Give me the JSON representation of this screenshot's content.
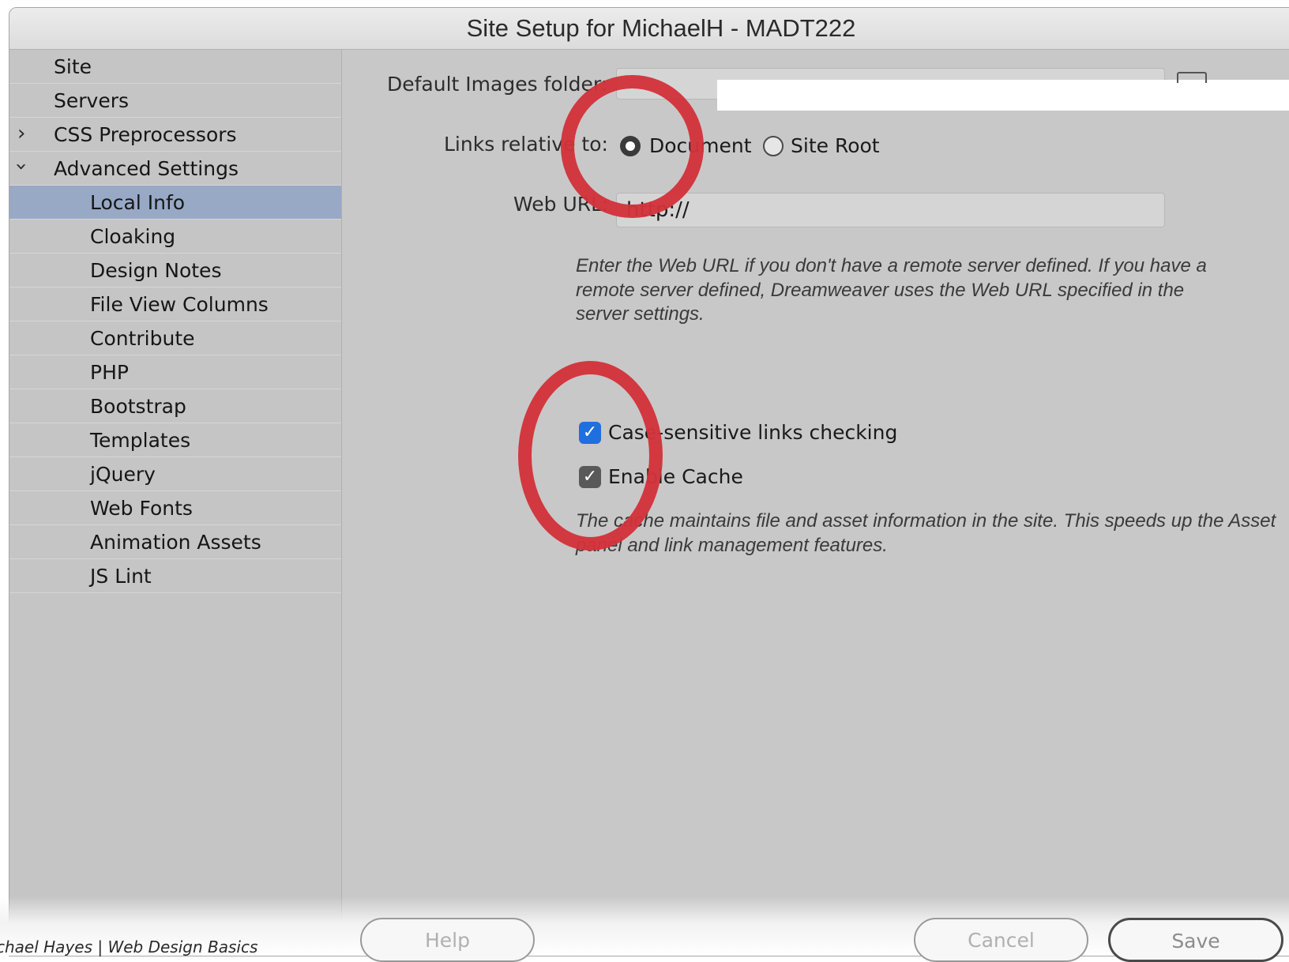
{
  "window": {
    "title": "Site Setup for MichaelH - MADT222"
  },
  "sidebar": {
    "items": [
      {
        "label": "Site"
      },
      {
        "label": "Servers"
      },
      {
        "label": "CSS Preprocessors",
        "chevron": "collapsed"
      },
      {
        "label": "Advanced Settings",
        "chevron": "expanded"
      },
      {
        "label": "Local Info",
        "selected": true
      },
      {
        "label": "Cloaking"
      },
      {
        "label": "Design Notes"
      },
      {
        "label": "File View Columns"
      },
      {
        "label": "Contribute"
      },
      {
        "label": "PHP"
      },
      {
        "label": "Bootstrap"
      },
      {
        "label": "Templates"
      },
      {
        "label": "jQuery"
      },
      {
        "label": "Web Fonts"
      },
      {
        "label": "Animation Assets"
      },
      {
        "label": "JS Lint"
      }
    ]
  },
  "main": {
    "default_images": {
      "label": "Default Images folder:",
      "value": ""
    },
    "links_relative": {
      "label": "Links relative to:",
      "options": [
        {
          "label": "Document",
          "selected": true
        },
        {
          "label": "Site Root",
          "selected": false
        }
      ]
    },
    "web_url": {
      "label": "Web URL:",
      "value": "http://",
      "description": "Enter the Web URL if you don't have a remote server defined. If you have a remote server defined, Dreamweaver uses the Web URL specified in the server settings."
    },
    "case_sensitive": {
      "label": "Case-sensitive links checking",
      "checked": true
    },
    "enable_cache": {
      "label": "Enable Cache",
      "checked": true
    },
    "cache_description": "The cache maintains file and asset information in the site. This speeds up the Asset panel and link management features."
  },
  "buttons": {
    "help": "Help",
    "cancel": "Cancel",
    "save": "Save"
  },
  "credit": "chael Hayes | Web Design Basics",
  "icons": {
    "checkmark": "✓",
    "chevron": "›",
    "folder": "folder-icon"
  },
  "colors": {
    "selection": "#98a9c6",
    "annotation": "#d2323a",
    "checkbox_blue": "#1f6fdf"
  }
}
